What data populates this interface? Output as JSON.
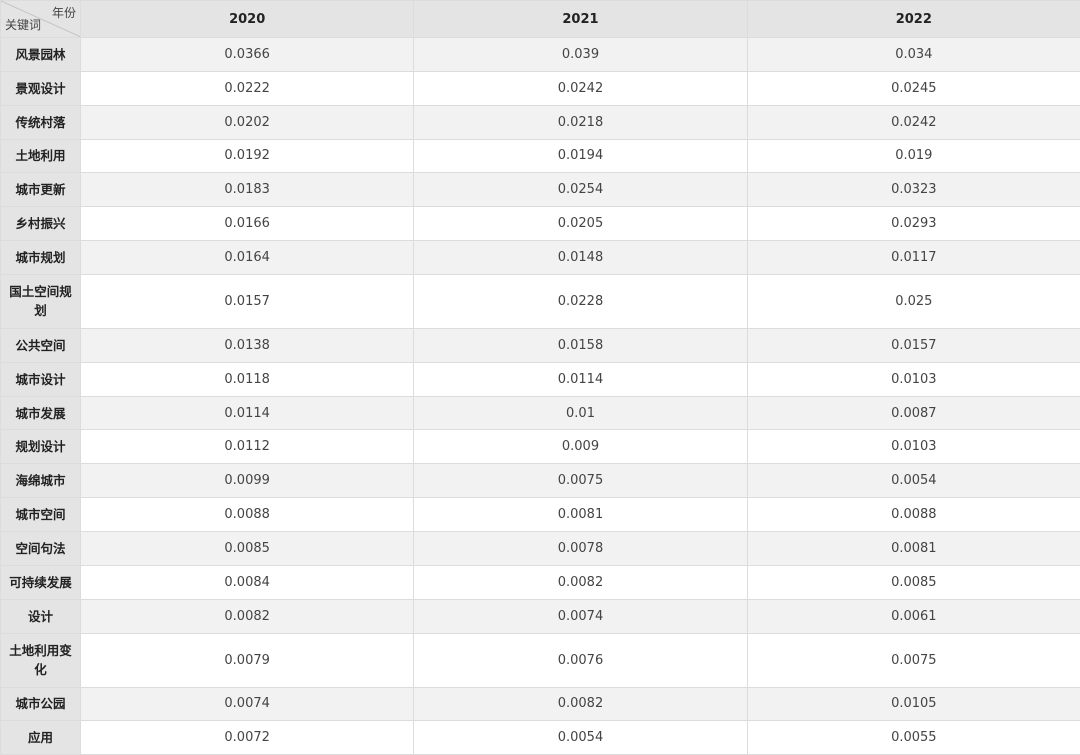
{
  "table": {
    "corner_column_label": "年份",
    "corner_row_label": "关键词",
    "columns": [
      "2020",
      "2021",
      "2022"
    ],
    "rows": [
      {
        "keyword": "风景园林",
        "values": [
          "0.0366",
          "0.039",
          "0.034"
        ]
      },
      {
        "keyword": "景观设计",
        "values": [
          "0.0222",
          "0.0242",
          "0.0245"
        ]
      },
      {
        "keyword": "传统村落",
        "values": [
          "0.0202",
          "0.0218",
          "0.0242"
        ]
      },
      {
        "keyword": "土地利用",
        "values": [
          "0.0192",
          "0.0194",
          "0.019"
        ]
      },
      {
        "keyword": "城市更新",
        "values": [
          "0.0183",
          "0.0254",
          "0.0323"
        ]
      },
      {
        "keyword": "乡村振兴",
        "values": [
          "0.0166",
          "0.0205",
          "0.0293"
        ]
      },
      {
        "keyword": "城市规划",
        "values": [
          "0.0164",
          "0.0148",
          "0.0117"
        ]
      },
      {
        "keyword": "国土空间规划",
        "values": [
          "0.0157",
          "0.0228",
          "0.025"
        ]
      },
      {
        "keyword": "公共空间",
        "values": [
          "0.0138",
          "0.0158",
          "0.0157"
        ]
      },
      {
        "keyword": "城市设计",
        "values": [
          "0.0118",
          "0.0114",
          "0.0103"
        ]
      },
      {
        "keyword": "城市发展",
        "values": [
          "0.0114",
          "0.01",
          "0.0087"
        ]
      },
      {
        "keyword": "规划设计",
        "values": [
          "0.0112",
          "0.009",
          "0.0103"
        ]
      },
      {
        "keyword": "海绵城市",
        "values": [
          "0.0099",
          "0.0075",
          "0.0054"
        ]
      },
      {
        "keyword": "城市空间",
        "values": [
          "0.0088",
          "0.0081",
          "0.0088"
        ]
      },
      {
        "keyword": "空间句法",
        "values": [
          "0.0085",
          "0.0078",
          "0.0081"
        ]
      },
      {
        "keyword": "可持续发展",
        "values": [
          "0.0084",
          "0.0082",
          "0.0085"
        ]
      },
      {
        "keyword": "设计",
        "values": [
          "0.0082",
          "0.0074",
          "0.0061"
        ]
      },
      {
        "keyword": "土地利用变化",
        "values": [
          "0.0079",
          "0.0076",
          "0.0075"
        ]
      },
      {
        "keyword": "城市公园",
        "values": [
          "0.0074",
          "0.0082",
          "0.0105"
        ]
      },
      {
        "keyword": "应用",
        "values": [
          "0.0072",
          "0.0054",
          "0.0055"
        ]
      }
    ]
  }
}
